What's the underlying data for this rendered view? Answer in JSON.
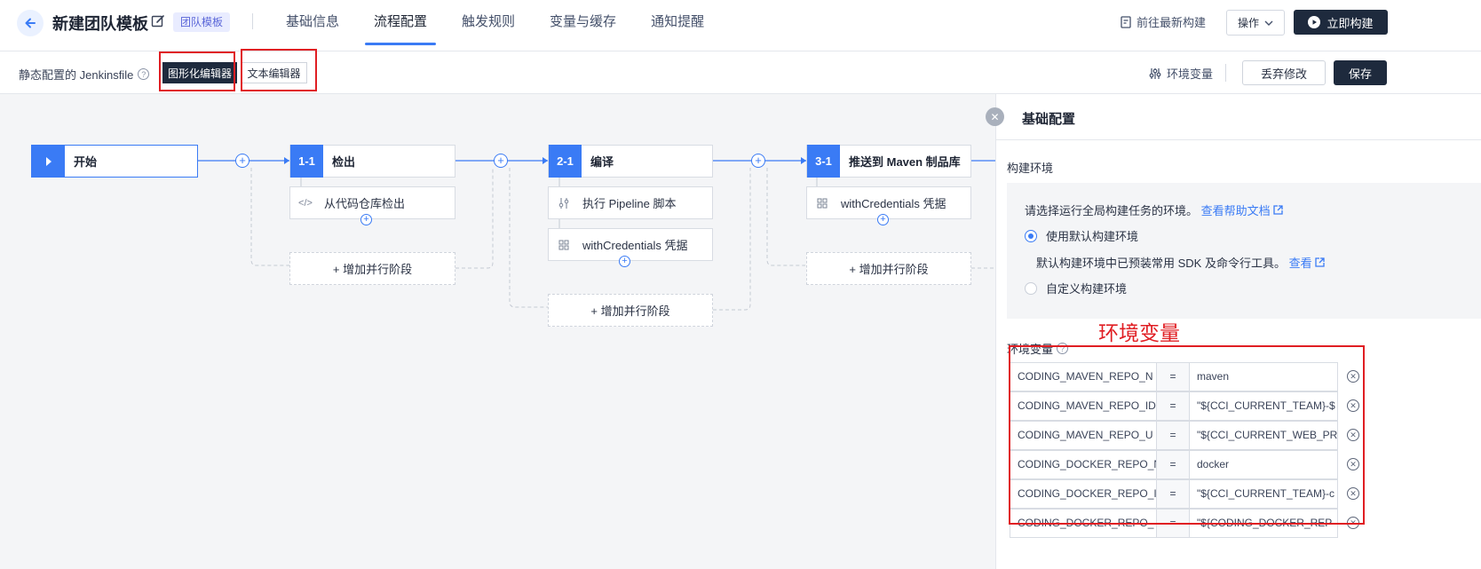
{
  "header": {
    "title": "新建团队模板",
    "badge": "团队模板",
    "tabs": [
      "基础信息",
      "流程配置",
      "触发规则",
      "变量与缓存",
      "通知提醒"
    ],
    "active_tab_index": 1,
    "goto_latest": "前往最新构建",
    "ops": "操作",
    "build_now": "立即构建"
  },
  "toolbar": {
    "static_label": "静态配置的 Jenkinsfile",
    "graph_editor": "图形化编辑器",
    "text_editor": "文本编辑器",
    "env_vars": "环境变量",
    "discard": "丢弃修改",
    "save": "保存"
  },
  "pipeline": {
    "start": "开始",
    "stages": [
      {
        "num": "1-1",
        "name": "检出",
        "steps": [
          {
            "icon": "code-icon",
            "label": "从代码仓库检出"
          }
        ]
      },
      {
        "num": "2-1",
        "name": "编译",
        "steps": [
          {
            "icon": "sliders-icon",
            "label": "执行 Pipeline 脚本"
          },
          {
            "icon": "grid-icon",
            "label": "withCredentials 凭据"
          }
        ]
      },
      {
        "num": "3-1",
        "name": "推送到 Maven 制品库",
        "steps": [
          {
            "icon": "grid-icon",
            "label": "withCredentials 凭据"
          }
        ]
      }
    ],
    "add_parallel": "+ 增加并行阶段"
  },
  "panel": {
    "title": "基础配置",
    "section_env": "构建环境",
    "env_desc": "请选择运行全局构建任务的环境。",
    "help_link": "查看帮助文档",
    "radio_default": "使用默认构建环境",
    "radio_default_note": "默认构建环境中已预装常用 SDK 及命令行工具。",
    "view_link": "查看",
    "radio_custom": "自定义构建环境",
    "selected_radio": "default",
    "annotation": "环境变量",
    "envvars_label": "环境变量",
    "vars": [
      {
        "key": "CODING_MAVEN_REPO_N",
        "eq": "=",
        "val": "maven"
      },
      {
        "key": "CODING_MAVEN_REPO_ID",
        "eq": "=",
        "val": "\"${CCI_CURRENT_TEAM}-$"
      },
      {
        "key": "CODING_MAVEN_REPO_U",
        "eq": "=",
        "val": "\"${CCI_CURRENT_WEB_PR"
      },
      {
        "key": "CODING_DOCKER_REPO_N",
        "eq": "=",
        "val": "docker"
      },
      {
        "key": "CODING_DOCKER_REPO_I",
        "eq": "=",
        "val": "\"${CCI_CURRENT_TEAM}-c"
      },
      {
        "key": "CODING_DOCKER_REPO_",
        "eq": "=",
        "val": "\"${CODING_DOCKER_REP"
      }
    ]
  },
  "colors": {
    "accent": "#3a7bf5",
    "dark": "#1e2a3d",
    "highlight": "#e01e23"
  }
}
